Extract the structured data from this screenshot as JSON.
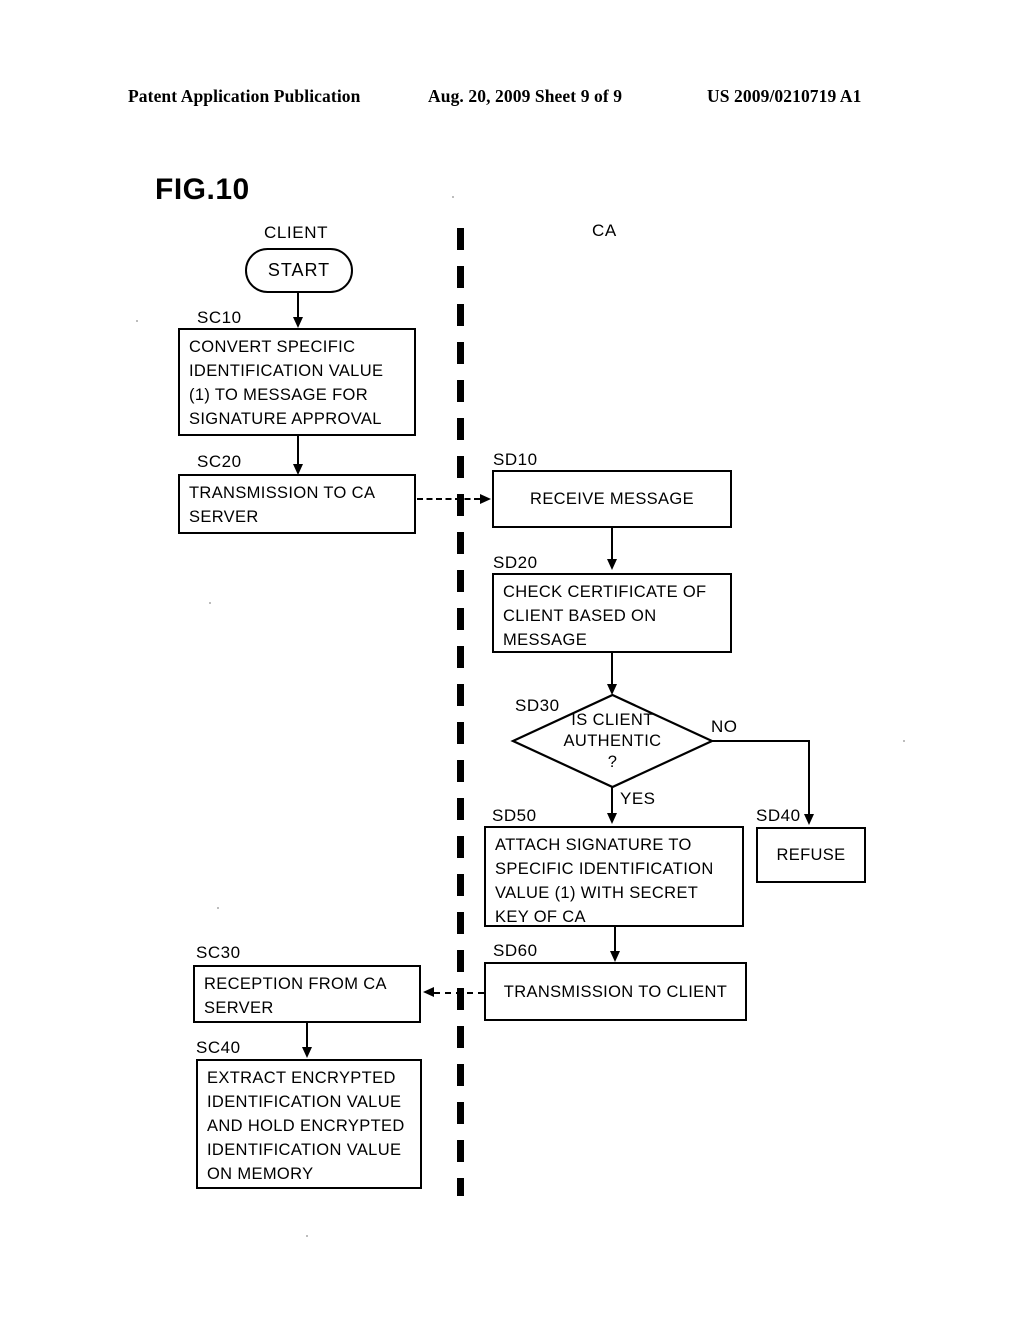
{
  "header": {
    "left": "Patent Application Publication",
    "middle": "Aug. 20, 2009  Sheet 9 of 9",
    "right": "US 2009/0210719 A1"
  },
  "figure": {
    "label": "FIG.10",
    "lanes": [
      {
        "name": "client",
        "title": "CLIENT"
      },
      {
        "name": "ca",
        "title": "CA"
      }
    ],
    "start": {
      "label": "START"
    },
    "branch_labels": {
      "yes": "YES",
      "no": "NO"
    },
    "nodes": [
      {
        "id": "SC10",
        "lane": "client",
        "text": "CONVERT SPECIFIC\nIDENTIFICATION VALUE\n(1) TO MESSAGE FOR\nSIGNATURE APPROVAL"
      },
      {
        "id": "SC20",
        "lane": "client",
        "text": "TRANSMISSION TO CA\nSERVER"
      },
      {
        "id": "SC30",
        "lane": "client",
        "text": "RECEPTION FROM CA\nSERVER"
      },
      {
        "id": "SC40",
        "lane": "client",
        "text": "EXTRACT ENCRYPTED\nIDENTIFICATION VALUE\nAND HOLD ENCRYPTED\nIDENTIFICATION VALUE\nON MEMORY"
      },
      {
        "id": "SD10",
        "lane": "ca",
        "text": "RECEIVE MESSAGE"
      },
      {
        "id": "SD20",
        "lane": "ca",
        "text": "CHECK CERTIFICATE OF\nCLIENT BASED ON\nMESSAGE"
      },
      {
        "id": "SD30",
        "lane": "ca",
        "text": "IS CLIENT\nAUTHENTIC\n?"
      },
      {
        "id": "SD40",
        "lane": "ca",
        "text": "REFUSE"
      },
      {
        "id": "SD50",
        "lane": "ca",
        "text": "ATTACH SIGNATURE TO\nSPECIFIC IDENTIFICATION\nVALUE (1) WITH SECRET\nKEY OF CA"
      },
      {
        "id": "SD60",
        "lane": "ca",
        "text": "TRANSMISSION TO CLIENT"
      }
    ]
  }
}
